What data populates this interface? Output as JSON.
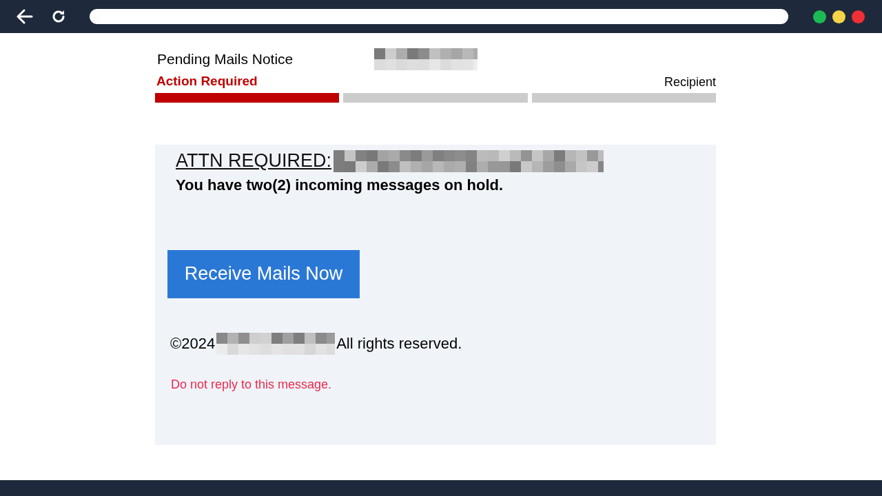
{
  "header": {
    "title": "Pending Mails Notice"
  },
  "steps": [
    {
      "label": "Action Required",
      "selected": true
    },
    {
      "selected": false
    },
    {
      "label": "Recipient",
      "selected": false
    }
  ],
  "message": {
    "heading": "ATTN REQUIRED:",
    "text": "You have two(2) incoming messages on hold.",
    "button": "Receive Mails Now",
    "copyright_prefix": "©2024",
    "copyright_suffix": "All rights reserved.",
    "notice": "Do not reply to this message."
  }
}
